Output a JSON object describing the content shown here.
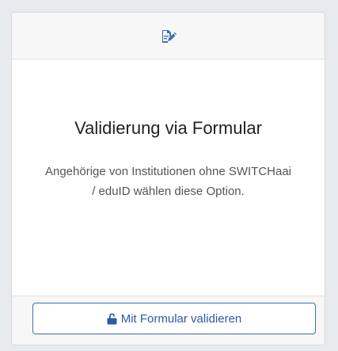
{
  "card": {
    "header_icon": "edit-document-icon",
    "title": "Validierung via Formular",
    "description": "Angehörige von Institutionen ohne SWITCHaai / eduID wählen diese Option.",
    "button": {
      "label": "Mit Formular validieren",
      "icon": "unlock-icon"
    }
  },
  "colors": {
    "accent": "#2a5aa8",
    "page_background": "#e8ebee",
    "header_background": "#f7f7f7"
  }
}
